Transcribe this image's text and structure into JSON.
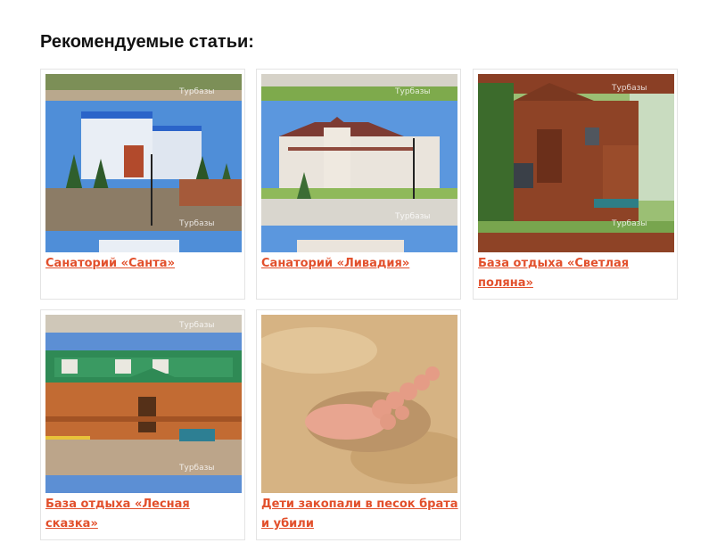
{
  "section": {
    "title": "Рекомендуемые статьи:"
  },
  "watermark": "Турбазы",
  "articles": [
    {
      "title": "Санаторий «Санта»"
    },
    {
      "title": "Санаторий «Ливадия»"
    },
    {
      "title": "База отдыха «Светлая поляна»"
    },
    {
      "title": "База отдыха «Лесная сказка»"
    },
    {
      "title": "Дети закопали в песок брата и убили"
    }
  ],
  "colors": {
    "link": "#e2502c",
    "border": "#e4e4e4",
    "heading": "#111111"
  }
}
